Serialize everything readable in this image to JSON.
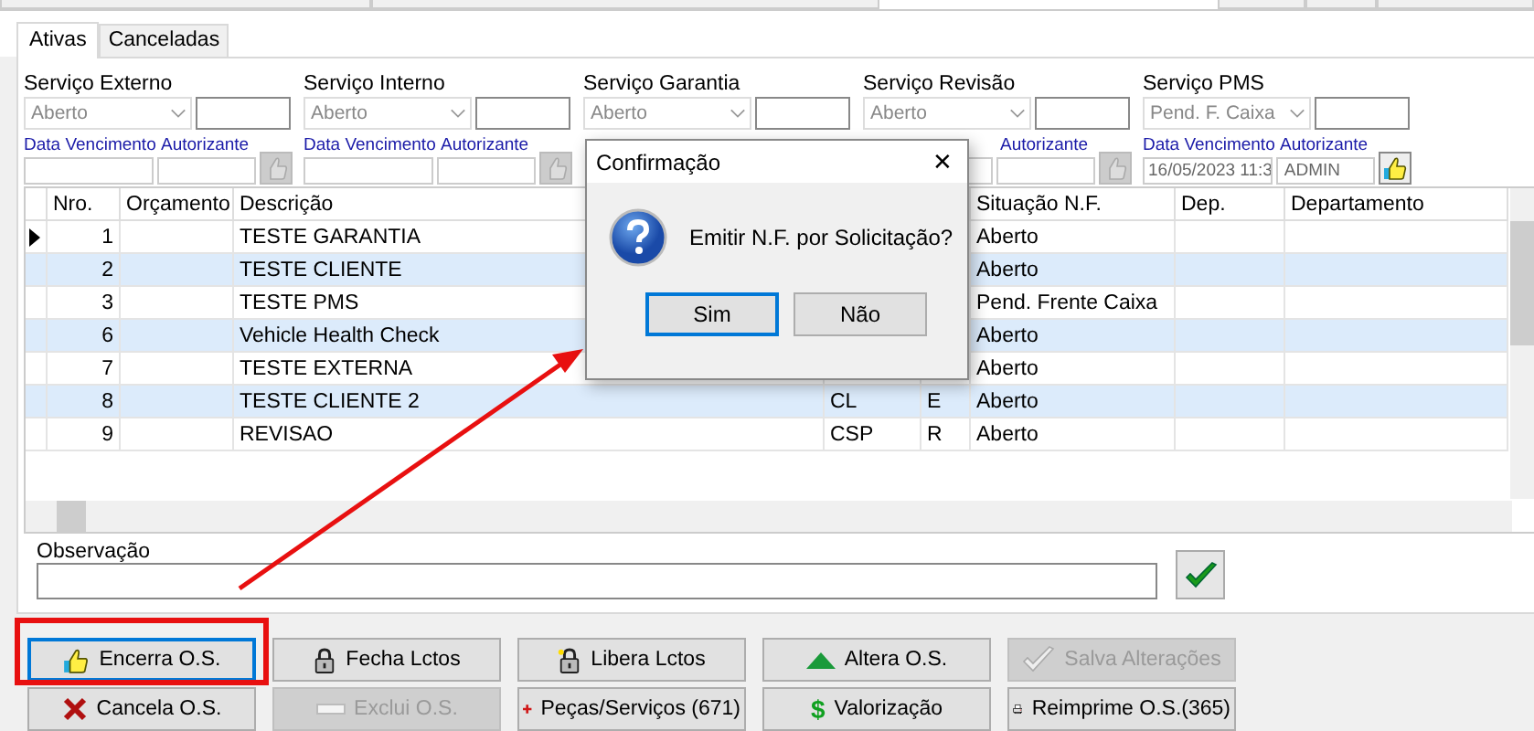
{
  "tabs": [
    {
      "label": "Ativas",
      "selected": true
    },
    {
      "label": "Canceladas",
      "selected": false
    }
  ],
  "filters": [
    {
      "label": "Serviço Externo",
      "status": "Aberto",
      "date_label": "Data Vencimento",
      "auth_label": "Autorizante",
      "approved": false
    },
    {
      "label": "Serviço Interno",
      "status": "Aberto",
      "date_label": "Data Vencimento",
      "auth_label": "Autorizante",
      "approved": false
    },
    {
      "label": "Serviço Garantia",
      "status": "Aberto"
    },
    {
      "label": "Serviço Revisão",
      "status": "Aberto",
      "auth_label": "Autorizante",
      "approved": false
    },
    {
      "label": "Serviço PMS",
      "status": "Pend. F. Caixa",
      "date_label": "Data Vencimento",
      "auth_label": "Autorizante",
      "date": "16/05/2023 11:3",
      "authorizer": "ADMIN",
      "approved": true
    }
  ],
  "table": {
    "columns": [
      "Nro.",
      "Orçamento",
      "Descrição",
      "",
      "",
      "Situação N.F.",
      "Dep.",
      "Departamento"
    ],
    "rows": [
      {
        "nro": "1",
        "descricao": "TESTE GARANTIA",
        "situacao": "Aberto",
        "selected": true
      },
      {
        "nro": "2",
        "descricao": "TESTE CLIENTE",
        "situacao": "Aberto",
        "selected": false
      },
      {
        "nro": "3",
        "descricao": "TESTE PMS",
        "situacao": "Pend. Frente Caixa",
        "selected": false
      },
      {
        "nro": "6",
        "descricao": "Vehicle Health Check",
        "situacao": "Aberto",
        "selected": false
      },
      {
        "nro": "7",
        "descricao": "TESTE EXTERNA",
        "situacao": "Aberto",
        "selected": false
      },
      {
        "nro": "8",
        "descricao": "TESTE CLIENTE 2",
        "column_4": "CL",
        "column_5": "E",
        "situacao": "Aberto",
        "selected": false
      },
      {
        "nro": "9",
        "descricao": "REVISAO",
        "column_4": "CSP",
        "column_5": "R",
        "situacao": "Aberto",
        "selected": false
      }
    ]
  },
  "observacao": {
    "label": "Observação"
  },
  "buttons": [
    {
      "label": "Encerra O.S.",
      "disabled": false,
      "focused": true
    },
    {
      "label": "Fecha Lctos",
      "disabled": false,
      "focused": false
    },
    {
      "label": "Libera Lctos",
      "disabled": false,
      "focused": false
    },
    {
      "label": "Altera O.S.",
      "disabled": false,
      "focused": false
    },
    {
      "label": "Salva Alterações",
      "disabled": true,
      "focused": false
    },
    {
      "label": "Cancela O.S.",
      "disabled": false,
      "focused": false
    },
    {
      "label": "Exclui O.S.",
      "disabled": true,
      "focused": false
    },
    {
      "label": "Peças/Serviços (671)",
      "disabled": false,
      "focused": false
    },
    {
      "label": "Valorização",
      "glyph": "$",
      "disabled": false,
      "focused": false
    },
    {
      "label": "Reimprime O.S.(365)",
      "disabled": false,
      "focused": false
    }
  ],
  "dialog": {
    "title": "Confirmação",
    "close": "✕",
    "message": "Emitir N.F. por Solicitação?",
    "buttons": [
      {
        "label": "Sim",
        "focused": true
      },
      {
        "label": "Não",
        "focused": false
      }
    ]
  }
}
